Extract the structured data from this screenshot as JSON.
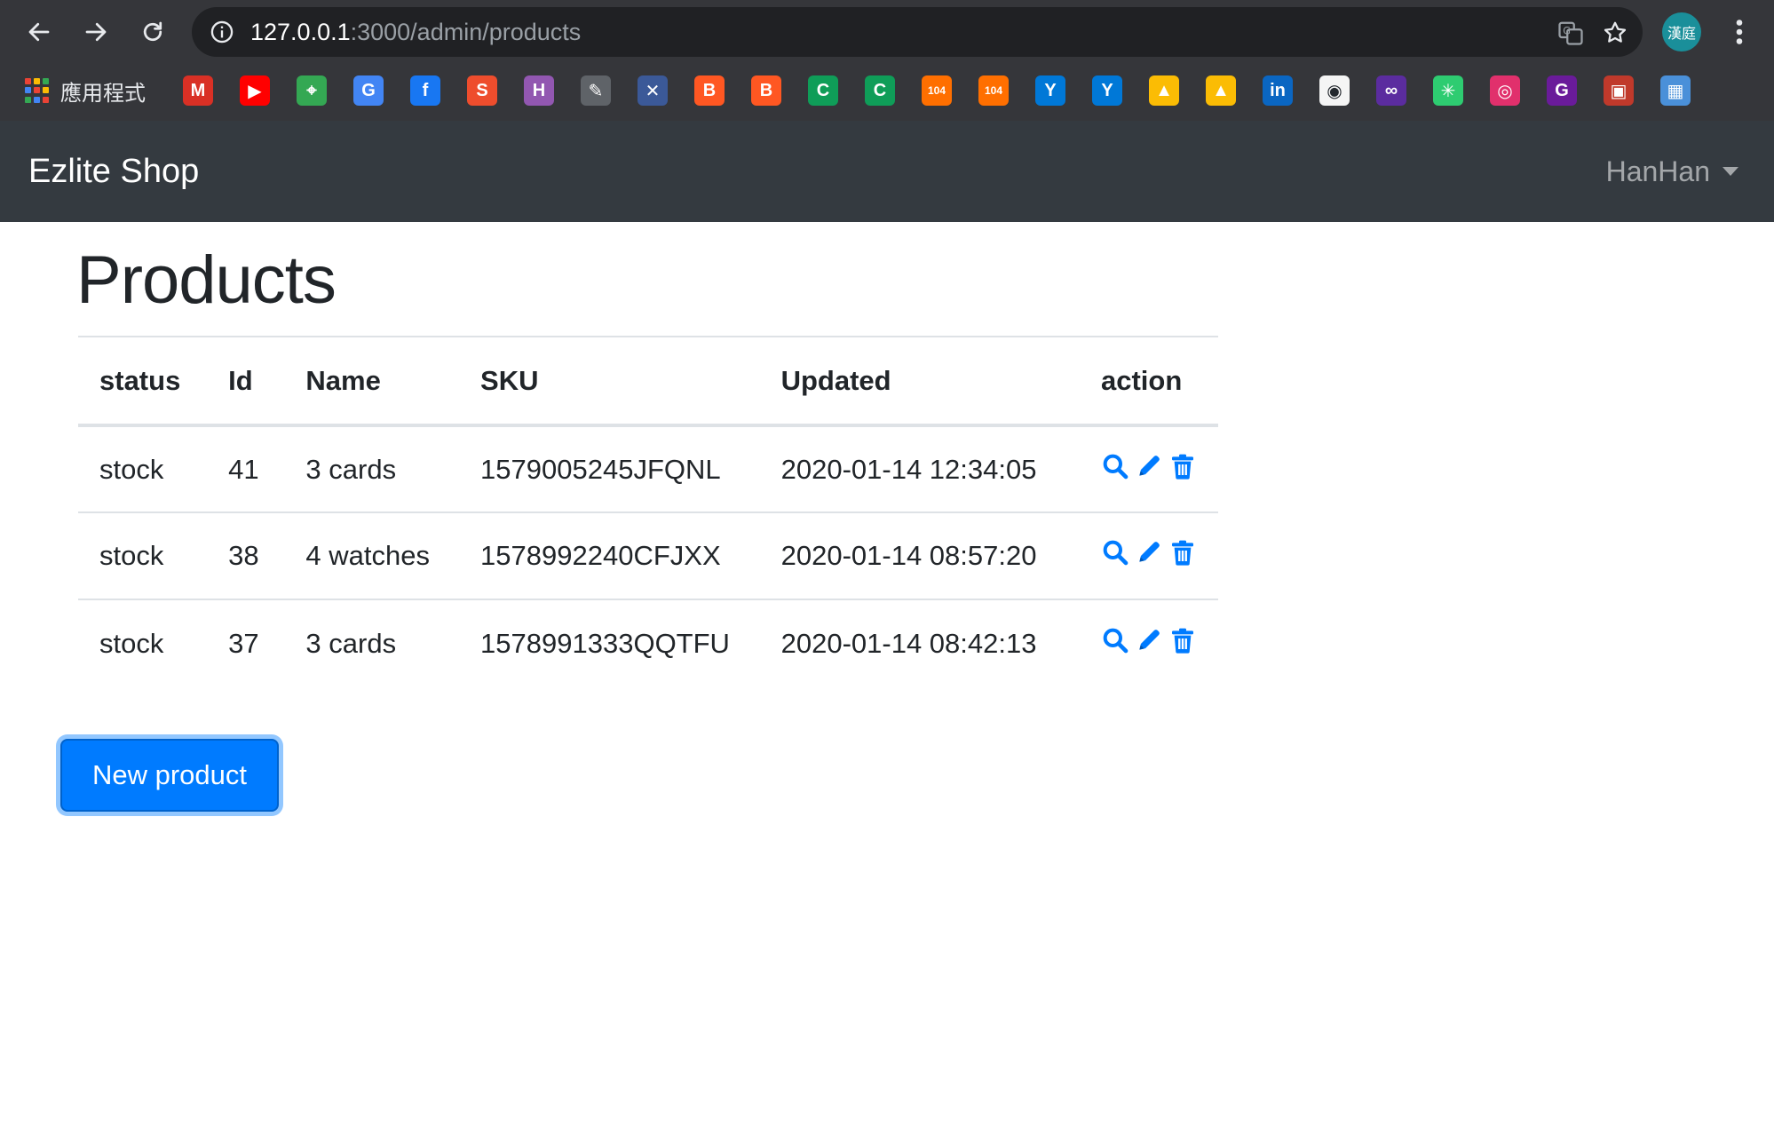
{
  "browser": {
    "url_host": "127.0.0.1",
    "url_path": ":3000/admin/products",
    "profile_initials": "漢庭",
    "apps_label": "應用程式",
    "bookmarks": [
      {
        "icon": "gmail-icon",
        "glyph": "M",
        "color": "#d93025"
      },
      {
        "icon": "youtube-icon",
        "glyph": "▶",
        "color": "#ff0000"
      },
      {
        "icon": "google-maps-icon",
        "glyph": "⌖",
        "color": "#34a853"
      },
      {
        "icon": "google-translate-icon",
        "glyph": "G",
        "color": "#4285f4"
      },
      {
        "icon": "facebook-icon",
        "glyph": "f",
        "color": "#1877f2"
      },
      {
        "icon": "shopee-icon",
        "glyph": "S",
        "color": "#ee4d2d"
      },
      {
        "icon": "hackmd-icon",
        "glyph": "H",
        "color": "#9257b1"
      },
      {
        "icon": "bookmark-icon-8",
        "glyph": "✎",
        "color": "#5f6368"
      },
      {
        "icon": "bookmark-icon-9",
        "glyph": "✕",
        "color": "#3b5998"
      },
      {
        "icon": "blogger-icon",
        "glyph": "B",
        "color": "#ff5722"
      },
      {
        "icon": "blogger-icon-2",
        "glyph": "B",
        "color": "#ff5722"
      },
      {
        "icon": "c-icon",
        "glyph": "C",
        "color": "#0f9d58"
      },
      {
        "icon": "c-icon-2",
        "glyph": "C",
        "color": "#0f9d58"
      },
      {
        "icon": "104-icon",
        "glyph": "104",
        "color": "#ff6f00"
      },
      {
        "icon": "104-icon-2",
        "glyph": "104",
        "color": "#ff6f00"
      },
      {
        "icon": "yourator-icon",
        "glyph": "Y",
        "color": "#0078d7"
      },
      {
        "icon": "yourator-icon-2",
        "glyph": "Y",
        "color": "#0078d7"
      },
      {
        "icon": "google-drive-icon",
        "glyph": "▲",
        "color": "#fbbc04"
      },
      {
        "icon": "google-drive-icon-2",
        "glyph": "▲",
        "color": "#fbbc04"
      },
      {
        "icon": "linkedin-icon",
        "glyph": "in",
        "color": "#0a66c2"
      },
      {
        "icon": "github-icon",
        "glyph": "◉",
        "color": "#f5f5f5"
      },
      {
        "icon": "bookmark-icon-22",
        "glyph": "∞",
        "color": "#5b2c9f"
      },
      {
        "icon": "bookmark-icon-23",
        "glyph": "✳",
        "color": "#2ecc71"
      },
      {
        "icon": "instagram-icon",
        "glyph": "◎",
        "color": "#e1306c"
      },
      {
        "icon": "bookmark-icon-25",
        "glyph": "G",
        "color": "#6a1b9a"
      },
      {
        "icon": "bookmark-icon-26",
        "glyph": "▣",
        "color": "#c0392b"
      },
      {
        "icon": "bookmark-icon-27",
        "glyph": "▦",
        "color": "#4a90d9"
      }
    ]
  },
  "navbar": {
    "brand": "Ezlite Shop",
    "user": "HanHan"
  },
  "page": {
    "title": "Products",
    "columns": [
      "status",
      "Id",
      "Name",
      "SKU",
      "Updated",
      "action"
    ],
    "rows": [
      {
        "status": "stock",
        "id": "41",
        "name": "3 cards",
        "sku": "1579005245JFQNL",
        "updated": "2020-01-14 12:34:05"
      },
      {
        "status": "stock",
        "id": "38",
        "name": "4 watches",
        "sku": "1578992240CFJXX",
        "updated": "2020-01-14 08:57:20"
      },
      {
        "status": "stock",
        "id": "37",
        "name": "3 cards",
        "sku": "1578991333QQTFU",
        "updated": "2020-01-14 08:42:13"
      }
    ],
    "new_button": "New product",
    "action_icons": [
      "search-icon",
      "pencil-icon",
      "trash-icon"
    ],
    "accent_color": "#007bff"
  }
}
